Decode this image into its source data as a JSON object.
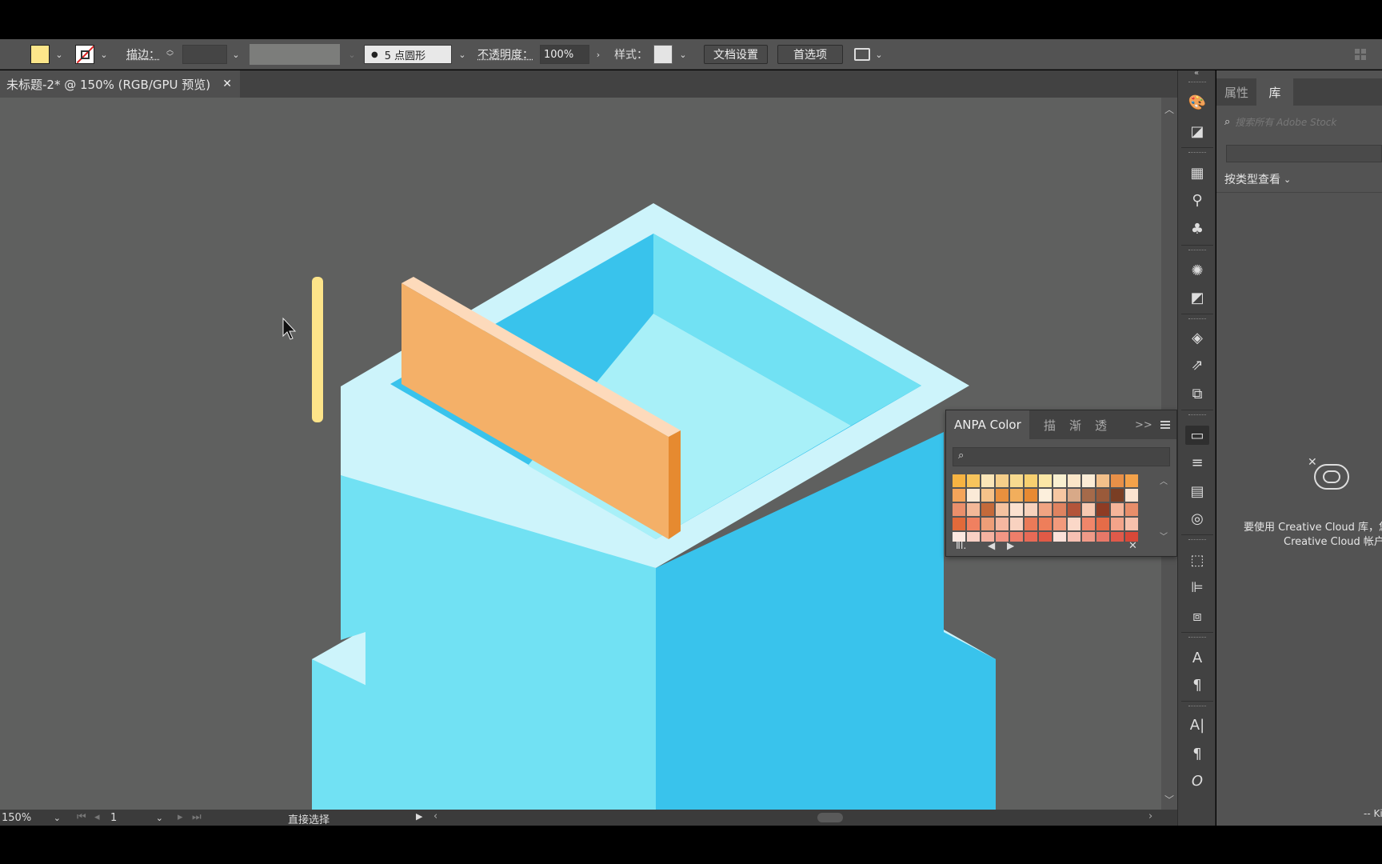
{
  "control_bar": {
    "fill_color": "#FDE68A",
    "stroke_label": "描边：",
    "stroke_weight_value": "",
    "brush_label": "5 点圆形",
    "opacity_label": "不透明度：",
    "opacity_value": "100%",
    "style_label": "样式：",
    "doc_settings_button": "文档设置",
    "preferences_button": "首选项"
  },
  "document_tab": {
    "title": "未标题-2* @ 150% (RGB/GPU 预览)",
    "close_glyph": "✕"
  },
  "status_bar": {
    "zoom_value": "150%",
    "artboard_number": "1",
    "tool_name": "直接选择"
  },
  "right_panel": {
    "tabs": [
      "属性",
      "库"
    ],
    "active_tab": "库",
    "search_placeholder": "搜索所有 Adobe Stock",
    "view_by_label": "按类型查看",
    "empty_message_line1": "要使用 Creative Cloud 库，您",
    "empty_message_line2": "Creative Cloud 帐户",
    "bottom_text": "-- Ki"
  },
  "anpa_panel": {
    "tabs": [
      "ANPA Color",
      "描边",
      "渐变",
      "透明"
    ],
    "tab_short": [
      "ANPA Color",
      "描",
      "渐",
      "透"
    ],
    "more_glyph": ">>",
    "swatch_rows": [
      [
        "#f6b342",
        "#f7c45c",
        "#fbe6b8",
        "#f6cf8a",
        "#f8da8f",
        "#f7d070",
        "#fbe7a6",
        "#f9f0d0",
        "#fbe6c8",
        "#fcecd6",
        "#f3c08a",
        "#e89048",
        "#f4a24a"
      ],
      [
        "#f4a45a",
        "#fbead7",
        "#f5c28a",
        "#e9903e",
        "#f2ae5c",
        "#e88a32",
        "#fcefdc",
        "#f6c7a2",
        "#d8a988",
        "#a56a4a",
        "#9a5a3a",
        "#7a3e24",
        "#fbe3d0"
      ],
      [
        "#ea8f6b",
        "#f3b898",
        "#c46a3a",
        "#f4c2a0",
        "#fbe1cf",
        "#f7d2bc",
        "#f0a482",
        "#e08360",
        "#b4553a",
        "#f7c9b1",
        "#8e3c24",
        "#f5b59a",
        "#e88e6a"
      ],
      [
        "#e16a3a",
        "#f08060",
        "#ee9e78",
        "#f5b7a0",
        "#f9d2c0",
        "#ea7a58",
        "#ee7e5a",
        "#f29a7c",
        "#fbd8c8",
        "#f0866a",
        "#e56c48",
        "#f3a48a",
        "#f7c1ac"
      ],
      [
        "#fce8e0",
        "#f9d0c4",
        "#f5b2a0",
        "#f29684",
        "#ee7e6a",
        "#e86a56",
        "#e05a46",
        "#fbe0d8",
        "#f6c0b2",
        "#f09a88",
        "#e87868",
        "#e05a4a",
        "#d84838"
      ]
    ]
  },
  "canvas_art": {
    "sky_color": "#5f605f",
    "box_light": "#71e1f3",
    "box_mid": "#39c3ec",
    "box_rim": "#cdf4fb",
    "box_inner_floor": "#a8f0f8",
    "plank_face": "#f4b068",
    "plank_top": "#fddabb",
    "plank_side": "#e68a30",
    "yellow_bar": "#fde489"
  }
}
